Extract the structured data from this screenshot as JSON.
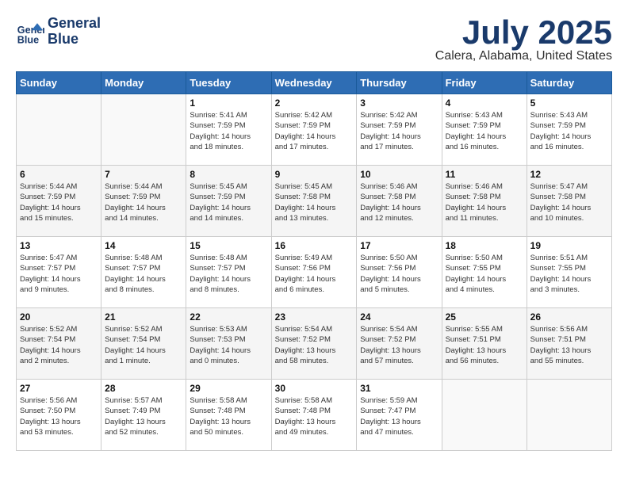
{
  "header": {
    "logo_line1": "General",
    "logo_line2": "Blue",
    "month": "July 2025",
    "location": "Calera, Alabama, United States"
  },
  "weekdays": [
    "Sunday",
    "Monday",
    "Tuesday",
    "Wednesday",
    "Thursday",
    "Friday",
    "Saturday"
  ],
  "weeks": [
    [
      {
        "day": "",
        "info": ""
      },
      {
        "day": "",
        "info": ""
      },
      {
        "day": "1",
        "info": "Sunrise: 5:41 AM\nSunset: 7:59 PM\nDaylight: 14 hours\nand 18 minutes."
      },
      {
        "day": "2",
        "info": "Sunrise: 5:42 AM\nSunset: 7:59 PM\nDaylight: 14 hours\nand 17 minutes."
      },
      {
        "day": "3",
        "info": "Sunrise: 5:42 AM\nSunset: 7:59 PM\nDaylight: 14 hours\nand 17 minutes."
      },
      {
        "day": "4",
        "info": "Sunrise: 5:43 AM\nSunset: 7:59 PM\nDaylight: 14 hours\nand 16 minutes."
      },
      {
        "day": "5",
        "info": "Sunrise: 5:43 AM\nSunset: 7:59 PM\nDaylight: 14 hours\nand 16 minutes."
      }
    ],
    [
      {
        "day": "6",
        "info": "Sunrise: 5:44 AM\nSunset: 7:59 PM\nDaylight: 14 hours\nand 15 minutes."
      },
      {
        "day": "7",
        "info": "Sunrise: 5:44 AM\nSunset: 7:59 PM\nDaylight: 14 hours\nand 14 minutes."
      },
      {
        "day": "8",
        "info": "Sunrise: 5:45 AM\nSunset: 7:59 PM\nDaylight: 14 hours\nand 14 minutes."
      },
      {
        "day": "9",
        "info": "Sunrise: 5:45 AM\nSunset: 7:58 PM\nDaylight: 14 hours\nand 13 minutes."
      },
      {
        "day": "10",
        "info": "Sunrise: 5:46 AM\nSunset: 7:58 PM\nDaylight: 14 hours\nand 12 minutes."
      },
      {
        "day": "11",
        "info": "Sunrise: 5:46 AM\nSunset: 7:58 PM\nDaylight: 14 hours\nand 11 minutes."
      },
      {
        "day": "12",
        "info": "Sunrise: 5:47 AM\nSunset: 7:58 PM\nDaylight: 14 hours\nand 10 minutes."
      }
    ],
    [
      {
        "day": "13",
        "info": "Sunrise: 5:47 AM\nSunset: 7:57 PM\nDaylight: 14 hours\nand 9 minutes."
      },
      {
        "day": "14",
        "info": "Sunrise: 5:48 AM\nSunset: 7:57 PM\nDaylight: 14 hours\nand 8 minutes."
      },
      {
        "day": "15",
        "info": "Sunrise: 5:48 AM\nSunset: 7:57 PM\nDaylight: 14 hours\nand 8 minutes."
      },
      {
        "day": "16",
        "info": "Sunrise: 5:49 AM\nSunset: 7:56 PM\nDaylight: 14 hours\nand 6 minutes."
      },
      {
        "day": "17",
        "info": "Sunrise: 5:50 AM\nSunset: 7:56 PM\nDaylight: 14 hours\nand 5 minutes."
      },
      {
        "day": "18",
        "info": "Sunrise: 5:50 AM\nSunset: 7:55 PM\nDaylight: 14 hours\nand 4 minutes."
      },
      {
        "day": "19",
        "info": "Sunrise: 5:51 AM\nSunset: 7:55 PM\nDaylight: 14 hours\nand 3 minutes."
      }
    ],
    [
      {
        "day": "20",
        "info": "Sunrise: 5:52 AM\nSunset: 7:54 PM\nDaylight: 14 hours\nand 2 minutes."
      },
      {
        "day": "21",
        "info": "Sunrise: 5:52 AM\nSunset: 7:54 PM\nDaylight: 14 hours\nand 1 minute."
      },
      {
        "day": "22",
        "info": "Sunrise: 5:53 AM\nSunset: 7:53 PM\nDaylight: 14 hours\nand 0 minutes."
      },
      {
        "day": "23",
        "info": "Sunrise: 5:54 AM\nSunset: 7:52 PM\nDaylight: 13 hours\nand 58 minutes."
      },
      {
        "day": "24",
        "info": "Sunrise: 5:54 AM\nSunset: 7:52 PM\nDaylight: 13 hours\nand 57 minutes."
      },
      {
        "day": "25",
        "info": "Sunrise: 5:55 AM\nSunset: 7:51 PM\nDaylight: 13 hours\nand 56 minutes."
      },
      {
        "day": "26",
        "info": "Sunrise: 5:56 AM\nSunset: 7:51 PM\nDaylight: 13 hours\nand 55 minutes."
      }
    ],
    [
      {
        "day": "27",
        "info": "Sunrise: 5:56 AM\nSunset: 7:50 PM\nDaylight: 13 hours\nand 53 minutes."
      },
      {
        "day": "28",
        "info": "Sunrise: 5:57 AM\nSunset: 7:49 PM\nDaylight: 13 hours\nand 52 minutes."
      },
      {
        "day": "29",
        "info": "Sunrise: 5:58 AM\nSunset: 7:48 PM\nDaylight: 13 hours\nand 50 minutes."
      },
      {
        "day": "30",
        "info": "Sunrise: 5:58 AM\nSunset: 7:48 PM\nDaylight: 13 hours\nand 49 minutes."
      },
      {
        "day": "31",
        "info": "Sunrise: 5:59 AM\nSunset: 7:47 PM\nDaylight: 13 hours\nand 47 minutes."
      },
      {
        "day": "",
        "info": ""
      },
      {
        "day": "",
        "info": ""
      }
    ]
  ]
}
